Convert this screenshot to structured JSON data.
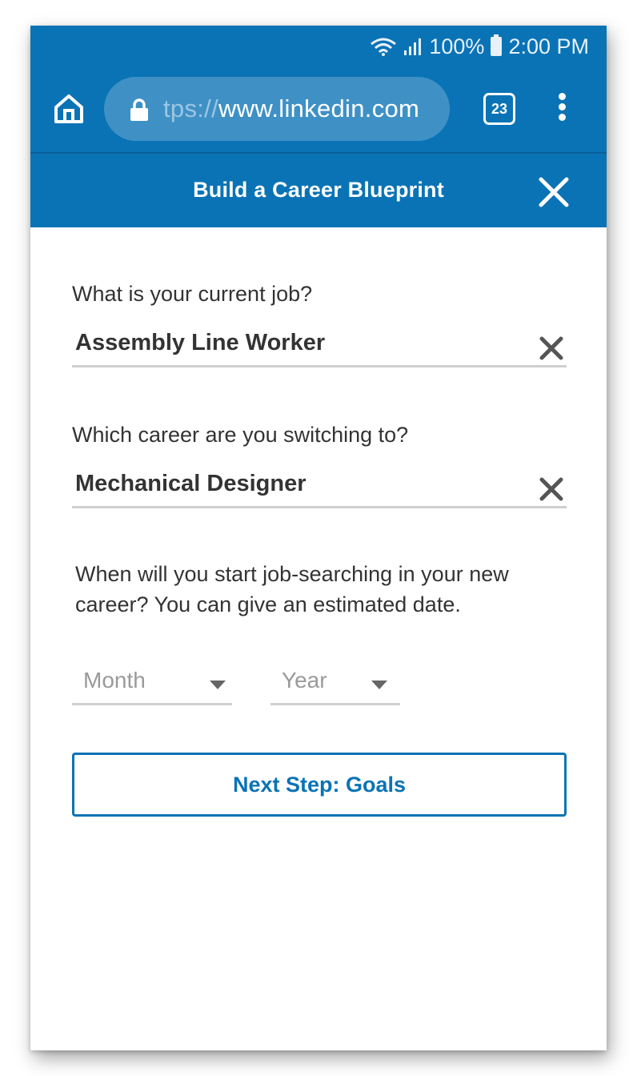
{
  "status_bar": {
    "battery_percent": "100%",
    "time": "2:00 PM",
    "icons": [
      "wifi-icon",
      "signal-icon",
      "battery-icon"
    ]
  },
  "browser": {
    "url_scheme_fragment": "tps://",
    "url_host": "www.linkedin.com",
    "tab_count": "23",
    "icons": [
      "home-icon",
      "lock-icon",
      "tabs-icon",
      "overflow-menu-icon"
    ]
  },
  "modal": {
    "title": "Build a Career Blueprint",
    "close_icon": "close-icon"
  },
  "form": {
    "current_job": {
      "label": "What is your current job?",
      "value": "Assembly Line Worker"
    },
    "target_career": {
      "label": "Which career are you switching to?",
      "value": "Mechanical Designer"
    },
    "start_date": {
      "label_line1": "When will you start job-searching in your new",
      "label_line2": "career? You can give an estimated date.",
      "month_placeholder": "Month",
      "year_placeholder": "Year"
    },
    "next_button": "Next Step: Goals"
  },
  "colors": {
    "brand_blue": "#0a73b5",
    "text_dark": "#333333",
    "placeholder_gray": "#9a9a9a",
    "underline_gray": "#cfcfcf"
  }
}
